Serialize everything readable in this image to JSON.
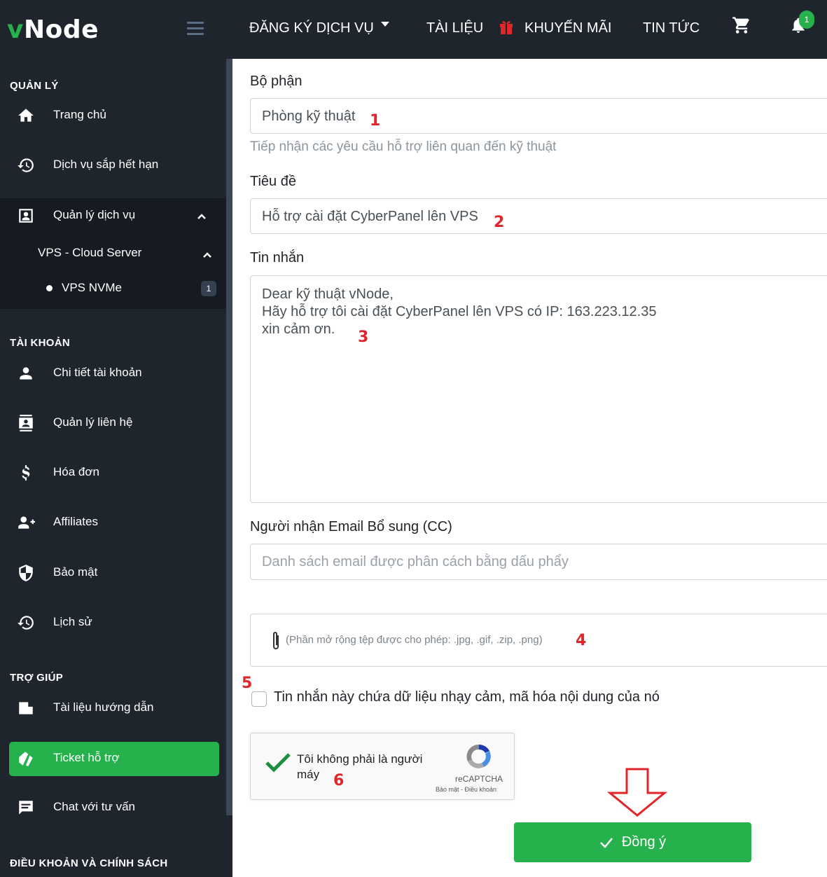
{
  "brand": {
    "logo_v": "v",
    "logo_rest": "Node"
  },
  "topnav": {
    "register": "ĐĂNG KÝ DỊCH VỤ",
    "docs": "TÀI LIỆU",
    "promo": "KHUYẾN MÃI",
    "news": "TIN TỨC",
    "notif_count": "1"
  },
  "sidebar": {
    "manage_title": "QUẢN LÝ",
    "home": "Trang chủ",
    "expiring": "Dịch vụ sắp hết hạn",
    "services": "Quản lý dịch vụ",
    "vps_cloud": "VPS - Cloud Server",
    "vps_nvme": "VPS NVMe",
    "vps_nvme_count": "1",
    "account_title": "TÀI KHOẢN",
    "account_details": "Chi tiết tài khoản",
    "contacts": "Quản lý liên hệ",
    "invoices": "Hóa đơn",
    "affiliates": "Affiliates",
    "security": "Bảo mật",
    "history": "Lịch sử",
    "help_title": "TRỢ GIÚP",
    "guides": "Tài liệu hướng dẫn",
    "ticket": "Ticket hỗ trợ",
    "chat": "Chat với tư vấn",
    "terms_title": "ĐIỀU KHOẢN VÀ CHÍNH SÁCH"
  },
  "form": {
    "department_label": "Bộ phận",
    "department_value": "Phòng kỹ thuật",
    "department_help": "Tiếp nhận các yêu cầu hỗ trợ liên quan đến kỹ thuật",
    "subject_label": "Tiêu đề",
    "subject_value": "Hỗ trợ cài đặt CyberPanel lên VPS",
    "message_label": "Tin nhắn",
    "message_value": "Dear kỹ thuật vNode,\nHãy hỗ trợ tôi cài đặt CyberPanel lên VPS có IP: 163.223.12.35\nxin cảm ơn.",
    "cc_label": "Người nhận Email Bổ sung (CC)",
    "cc_placeholder": "Danh sách email được phân cách bằng dấu phẩy",
    "attach_note": "(Phần mở rộng tệp được cho phép: .jpg, .gif, .zip, .png)",
    "sensitive_label": "Tin nhắn này chứa dữ liệu nhạy cảm, mã hóa nội dung của nó",
    "captcha_text": "Tôi không phải là người máy",
    "captcha_brand": "reCAPTCHA",
    "captcha_links": "Bảo mật - Điều khoản",
    "submit": "Đồng ý"
  },
  "annotations": {
    "n1": "1",
    "n2": "2",
    "n3": "3",
    "n4": "4",
    "n5": "5",
    "n6": "6"
  },
  "colors": {
    "accent": "#26b14d",
    "sidebar_bg": "#1e252d",
    "annotation_red": "#e0262b"
  }
}
